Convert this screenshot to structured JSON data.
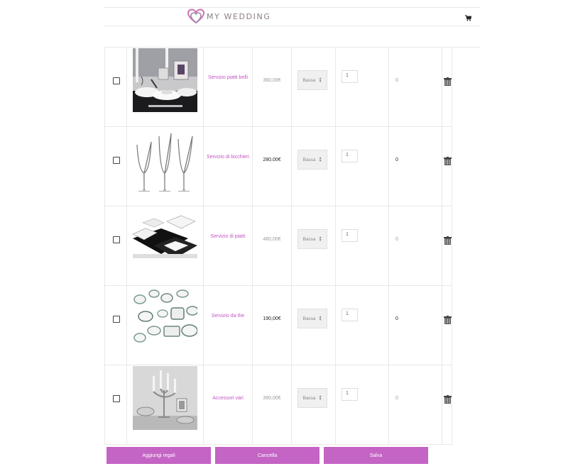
{
  "header": {
    "brand": "MY WEDDING",
    "logo_icon": "double-heart-icon",
    "cart_icon": "cart-icon",
    "brand_color": "#c353c3"
  },
  "gifts": [
    {
      "name": "Servizio piatti belli",
      "price": "360,00€",
      "priority": "Bassa",
      "quantity": "1",
      "received": "0",
      "image": "table-setting"
    },
    {
      "name": "Servizio di bicchieri",
      "price": "280,00€",
      "priority": "Bassa",
      "quantity": "1",
      "received": "0",
      "image": "wine-glasses"
    },
    {
      "name": "Servizio di piatti",
      "price": "480,00€",
      "priority": "Bassa",
      "quantity": "1",
      "received": "0",
      "image": "black-white-plates"
    },
    {
      "name": "Servizio da the",
      "price": "190,00€",
      "priority": "Bassa",
      "quantity": "1",
      "received": "0",
      "image": "tea-set"
    },
    {
      "name": "Accessori vari",
      "price": "390,00€",
      "priority": "Bassa",
      "quantity": "1",
      "received": "0",
      "image": "candelabra"
    }
  ],
  "actions": {
    "add_label": "Aggiungi regali",
    "cancel_label": "Cancella",
    "save_label": "Salva",
    "button_color": "#c464c4"
  }
}
